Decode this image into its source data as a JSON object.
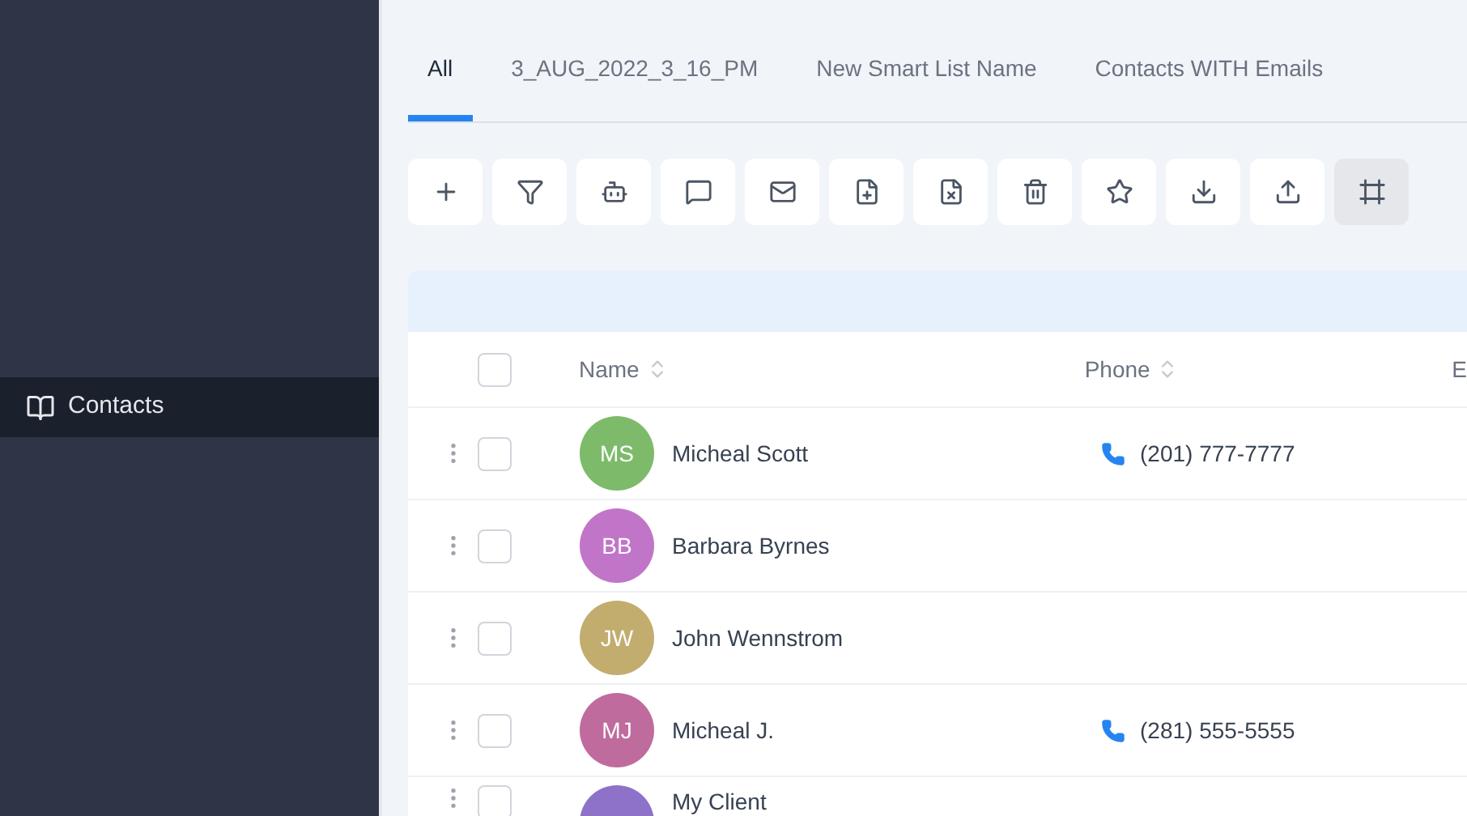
{
  "sidebar": {
    "items": [
      {
        "label": "Contacts",
        "selected": true
      }
    ]
  },
  "tabs": [
    {
      "label": "All",
      "selected": true
    },
    {
      "label": "3_AUG_2022_3_16_PM",
      "selected": false
    },
    {
      "label": "New Smart List Name",
      "selected": false
    },
    {
      "label": "Contacts WITH Emails",
      "selected": false
    }
  ],
  "toolbar": [
    {
      "kind": "add",
      "selected": false
    },
    {
      "kind": "filter",
      "selected": false
    },
    {
      "kind": "bot",
      "selected": false
    },
    {
      "kind": "message",
      "selected": false
    },
    {
      "kind": "mail",
      "selected": false
    },
    {
      "kind": "tag-add",
      "selected": false
    },
    {
      "kind": "tag-remove",
      "selected": false
    },
    {
      "kind": "delete",
      "selected": false
    },
    {
      "kind": "star",
      "selected": false
    },
    {
      "kind": "download",
      "selected": false
    },
    {
      "kind": "upload",
      "selected": false
    },
    {
      "kind": "frame",
      "selected": true
    }
  ],
  "table": {
    "all_checked": false,
    "columns": [
      {
        "label": "Name",
        "sortable": true
      },
      {
        "label": "Phone",
        "sortable": true
      },
      {
        "label": "E",
        "sortable": false
      }
    ],
    "rows": [
      {
        "initials": "MS",
        "color": "#7dbb6b",
        "name": "Micheal Scott",
        "phone": "(201) 777-7777",
        "checked": false
      },
      {
        "initials": "BB",
        "color": "#c175c9",
        "name": "Barbara Byrnes",
        "checked": false
      },
      {
        "initials": "JW",
        "color": "#c2ad6f",
        "name": "John Wennstrom",
        "checked": false
      },
      {
        "initials": "MJ",
        "color": "#c06b9e",
        "name": "Micheal J.",
        "phone": "(281) 555-5555",
        "checked": false
      },
      {
        "color": "#8e72c9",
        "name": "My Client",
        "checked": false
      }
    ]
  }
}
